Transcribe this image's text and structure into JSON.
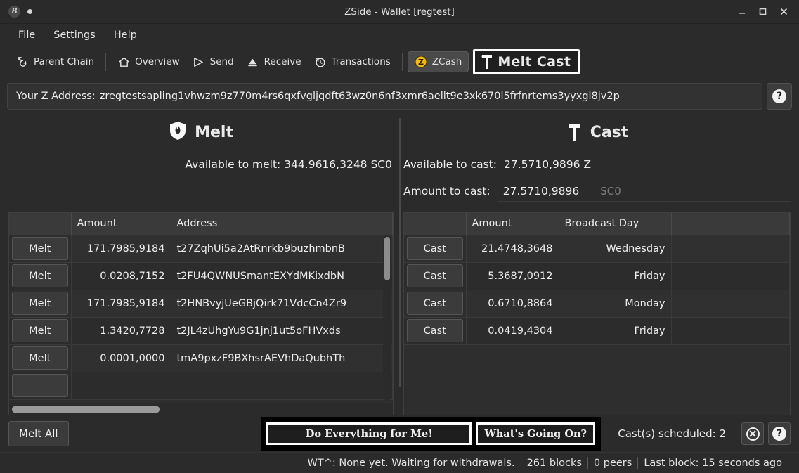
{
  "window": {
    "title": "ZSide - Wallet [regtest]",
    "app_icon": "bitcoin-icon",
    "controls": {
      "minimize": "minimize-icon",
      "maximize": "maximize-icon",
      "close": "close-icon"
    }
  },
  "menubar": {
    "items": [
      "File",
      "Settings",
      "Help"
    ]
  },
  "toolbar": {
    "items": [
      {
        "label": "Parent Chain",
        "icon": "parent-chain-icon",
        "active": false
      },
      {
        "label": "Overview",
        "icon": "home-icon",
        "active": false
      },
      {
        "label": "Send",
        "icon": "send-icon",
        "active": false
      },
      {
        "label": "Receive",
        "icon": "receive-icon",
        "active": false
      },
      {
        "label": "Transactions",
        "icon": "history-icon",
        "active": false
      },
      {
        "label": "ZCash",
        "icon": "zcash-icon",
        "active": true
      }
    ],
    "melt_cast": {
      "icon": "hammer-icon",
      "label_melt": "Melt",
      "label_cast": "Cast",
      "selected": true
    }
  },
  "address_bar": {
    "label": "Your Z Address:",
    "value": "zregtestsapling1vhwzm9z770m4rs6qxfvgljqdft63wz0n6nf3xmr6aellt9e3xk670l5frfnrtems3yyxgl8jv2p",
    "help_icon": "question-mark-icon",
    "help_label": "?"
  },
  "melt_panel": {
    "icon": "shield-flame-icon",
    "title": "Melt",
    "available_label": "Available to melt:",
    "available_value": "344.9616,3248 SC0",
    "available_full": "Available to melt: 344.9616,3248 SC0",
    "table": {
      "columns": [
        "",
        "Amount",
        "Address"
      ],
      "rows": [
        {
          "action": "Melt",
          "amount": "171.7985,9184",
          "address": "t27ZqhUi5a2AtRnrkb9buzhmbnB"
        },
        {
          "action": "Melt",
          "amount": "0.0208,7152",
          "address": "t2FU4QWNUSmantEXYdMKixdbN"
        },
        {
          "action": "Melt",
          "amount": "171.7985,9184",
          "address": "t2HNBvyjUeGBjQirk71VdcCn4Zr9"
        },
        {
          "action": "Melt",
          "amount": "1.3420,7728",
          "address": "t2JL4zUhgYu9G1jnj1ut5oFHVxds"
        },
        {
          "action": "Melt",
          "amount": "0.0001,0000",
          "address": "tmA9pxzF9BXhsrAEVhDaQubhTh"
        },
        {
          "action": "",
          "amount": "",
          "address": ""
        }
      ]
    },
    "melt_all_label": "Melt All"
  },
  "cast_panel": {
    "icon": "hammer-icon",
    "title": "Cast",
    "available_label": "Available to cast:",
    "available_value": "27.5710,9896 Z",
    "amount_label": "Amount to cast:",
    "amount_value": "27.5710,9896",
    "amount_suffix": "SC0",
    "table": {
      "columns": [
        "",
        "Amount",
        "Broadcast Day",
        ""
      ],
      "rows": [
        {
          "action": "Cast",
          "amount": "21.4748,3648",
          "day": "Wednesday"
        },
        {
          "action": "Cast",
          "amount": "5.3687,0912",
          "day": "Friday"
        },
        {
          "action": "Cast",
          "amount": "0.6710,8864",
          "day": "Monday"
        },
        {
          "action": "Cast",
          "amount": "0.0419,4304",
          "day": "Friday"
        }
      ]
    }
  },
  "actions": {
    "do_everything_label": "Do Everything for Me!",
    "whats_going_on_label": "What's Going On?",
    "cast_scheduled_label": "Cast(s) scheduled: 2",
    "cancel_icon": "cancel-circle-icon",
    "help_icon": "question-mark-icon",
    "help_label": "?"
  },
  "statusbar": {
    "wt_status": "WT^: None yet. Waiting for withdrawals.",
    "blocks": "261 blocks",
    "peers": "0 peers",
    "last_block": "Last block: 15 seconds ago"
  },
  "colors": {
    "accent_white": "#ffffff",
    "zcash_gold": "#f0b90b",
    "window_bg": "#2b2b2b",
    "table_bg": "#303030"
  }
}
